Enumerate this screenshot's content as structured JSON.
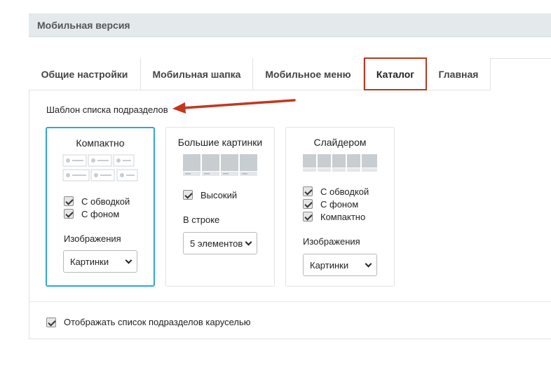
{
  "section": {
    "title": "Мобильная версия"
  },
  "tabs": [
    {
      "label": "Общие настройки",
      "active": false
    },
    {
      "label": "Мобильная шапка",
      "active": false
    },
    {
      "label": "Мобильное меню",
      "active": false
    },
    {
      "label": "Каталог",
      "active": true
    },
    {
      "label": "Главная",
      "active": false
    }
  ],
  "template": {
    "label": "Шаблон списка подразделов"
  },
  "cards": [
    {
      "title": "Компактно",
      "icon": "compact-list-icon",
      "selected": true,
      "checkboxes": [
        {
          "label": "С обводкой",
          "checked": true
        },
        {
          "label": "С фоном",
          "checked": true
        }
      ],
      "images_label": "Изображения",
      "images_value": "Картинки"
    },
    {
      "title": "Большие картинки",
      "icon": "big-images-icon",
      "selected": false,
      "checkboxes": [
        {
          "label": "Высокий",
          "checked": true
        }
      ],
      "row_label": "В строке",
      "row_value": "5 элементов"
    },
    {
      "title": "Слайдером",
      "icon": "slider-icon",
      "selected": false,
      "checkboxes": [
        {
          "label": "С обводкой",
          "checked": true
        },
        {
          "label": "С фоном",
          "checked": true
        },
        {
          "label": "Компактно",
          "checked": true
        }
      ],
      "images_label": "Изображения",
      "images_value": "Картинки"
    }
  ],
  "carousel": {
    "label": "Отображать список подразделов каруселью",
    "checked": true
  },
  "colors": {
    "accent_tab": "#b43a22",
    "selected_card": "#2fa7d9",
    "arrow": "#c0391f"
  }
}
